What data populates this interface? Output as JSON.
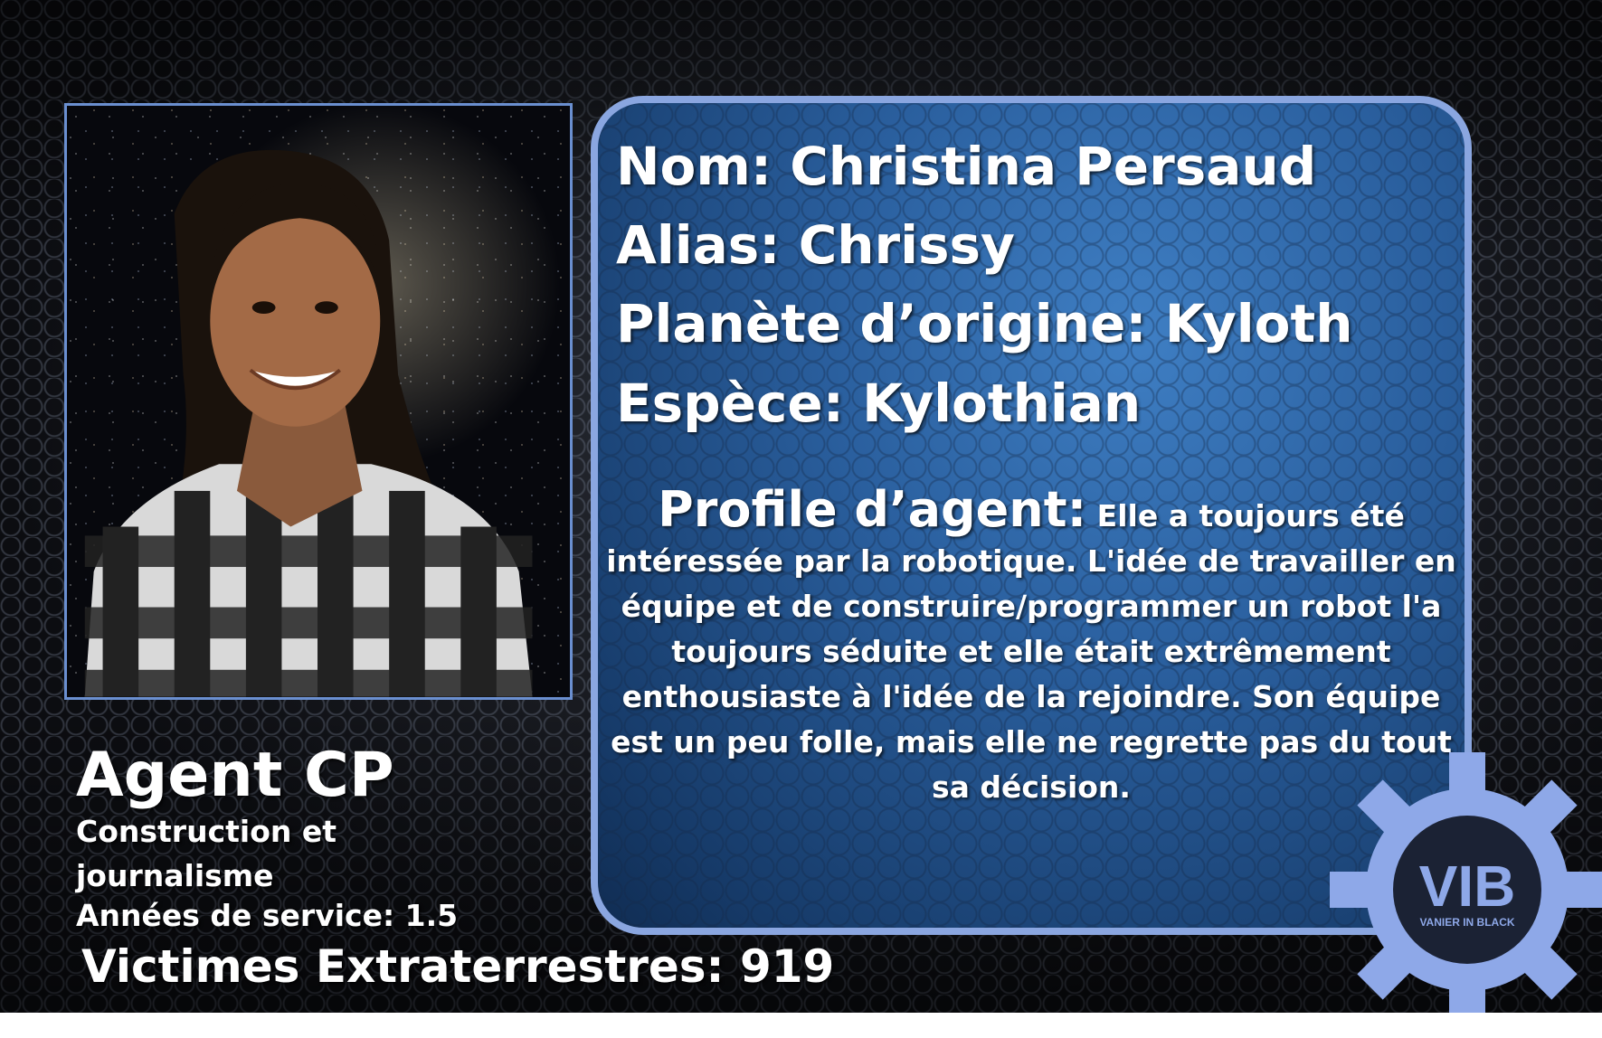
{
  "profile": {
    "nom": "Nom: Christina Persaud",
    "alias": "Alias: Chrissy",
    "planete": "Planète d’origine: Kyloth",
    "espece": "Espèce: Kylothian",
    "profile_label": "Profile d’agent:",
    "profile_text": "Elle a toujours été intéressée par la robotique. L'idée de travailler en équipe et de construire/programmer un robot l'a toujours séduite et elle était extrêmement enthousiaste à l'idée de la rejoindre. Son équipe est un peu folle, mais elle ne regrette pas du tout sa décision."
  },
  "agent": {
    "name": "Agent CP",
    "department": "Construction et journalisme",
    "years": "Années de service: 1.5",
    "victims": "Victimes Extraterrestres: 919"
  },
  "logo": {
    "letters": "VIB",
    "tagline": "VANIER IN BLACK",
    "icon": "gear-icon"
  },
  "colors": {
    "panel_border": "#8aa6e0",
    "panel_fill": "#2a5f9e",
    "photo_border": "#6a8fd0",
    "gear": "#8ea8e8",
    "text": "#ffffff"
  }
}
